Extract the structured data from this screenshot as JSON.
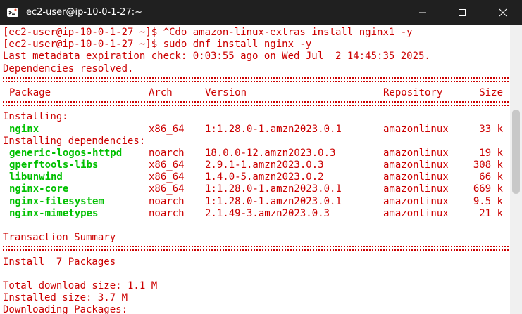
{
  "window": {
    "title": "ec2-user@ip-10-0-1-27:~",
    "controls": {
      "minimize": "minimize",
      "maximize": "maximize",
      "close": "close"
    }
  },
  "terminal": {
    "prompt_lines": [
      "[ec2-user@ip-10-0-1-27 ~]$ ^Cdo amazon-linux-extras install nginx1 -y",
      "[ec2-user@ip-10-0-1-27 ~]$ sudo dnf install nginx -y"
    ],
    "metadata_line": "Last metadata expiration check: 0:03:55 ago on Wed Jul  2 14:45:35 2025.",
    "deps_resolved": "Dependencies resolved.",
    "table_header": {
      "package": "Package",
      "arch": "Arch",
      "version": "Version",
      "repository": "Repository",
      "size": "Size"
    },
    "installing_label": "Installing:",
    "installing": [
      {
        "name": "nginx",
        "arch": "x86_64",
        "version": "1:1.28.0-1.amzn2023.0.1",
        "repo": "amazonlinux",
        "size": "33 k"
      }
    ],
    "deps_label": "Installing dependencies:",
    "dependencies": [
      {
        "name": "generic-logos-httpd",
        "arch": "noarch",
        "version": "18.0.0-12.amzn2023.0.3",
        "repo": "amazonlinux",
        "size": "19 k"
      },
      {
        "name": "gperftools-libs",
        "arch": "x86_64",
        "version": "2.9.1-1.amzn2023.0.3",
        "repo": "amazonlinux",
        "size": "308 k"
      },
      {
        "name": "libunwind",
        "arch": "x86_64",
        "version": "1.4.0-5.amzn2023.0.2",
        "repo": "amazonlinux",
        "size": "66 k"
      },
      {
        "name": "nginx-core",
        "arch": "x86_64",
        "version": "1:1.28.0-1.amzn2023.0.1",
        "repo": "amazonlinux",
        "size": "669 k"
      },
      {
        "name": "nginx-filesystem",
        "arch": "noarch",
        "version": "1:1.28.0-1.amzn2023.0.1",
        "repo": "amazonlinux",
        "size": "9.5 k"
      },
      {
        "name": "nginx-mimetypes",
        "arch": "noarch",
        "version": "2.1.49-3.amzn2023.0.3",
        "repo": "amazonlinux",
        "size": "21 k"
      }
    ],
    "transaction_summary": "Transaction Summary",
    "install_count": "Install  7 Packages",
    "total_download": "Total download size: 1.1 M",
    "installed_size": "Installed size: 3.7 M",
    "downloading": "Downloading Packages:"
  },
  "colors": {
    "titlebar": "#202020",
    "terminal_bg": "#ffffff",
    "text_red": "#cc0000",
    "text_green": "#00c000"
  }
}
